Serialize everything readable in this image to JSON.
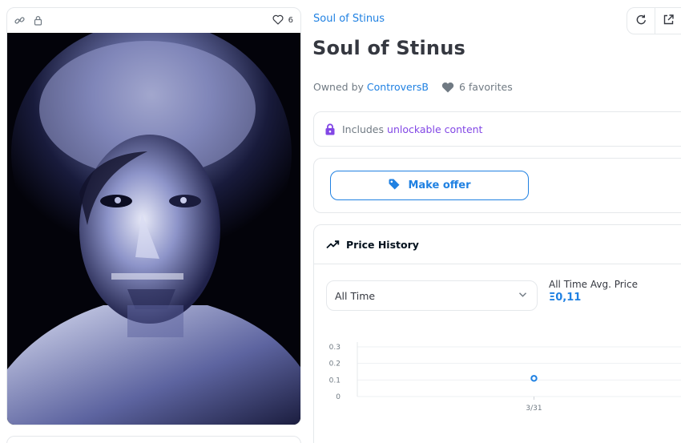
{
  "asset": {
    "favorite_count": "6",
    "collection_name": "Soul of Stinus",
    "title": "Soul of Stinus",
    "owned_by_label": "Owned by",
    "owner_name": "ControversB",
    "favorites_text": "6 favorites"
  },
  "unlockable": {
    "prefix": "Includes",
    "link": "unlockable content"
  },
  "offer": {
    "button_label": "Make offer"
  },
  "price_history": {
    "title": "Price History",
    "range_selected": "All Time",
    "avg_label": "All Time Avg. Price",
    "avg_value": "Ξ0,11"
  },
  "icons": {
    "toolbar": [
      "link-icon",
      "lock-icon",
      "heart-outline-icon"
    ],
    "actions": [
      "refresh-icon",
      "external-link-icon"
    ],
    "accent": "#2081e2",
    "unlock_accent": "#8247e5"
  },
  "chart_data": {
    "type": "scatter",
    "x_ticks": [
      "3/31"
    ],
    "y_ticks": [
      "0.3",
      "0.2",
      "0.1",
      "0"
    ],
    "ylim": [
      0,
      0.3
    ],
    "points": [
      {
        "x": "3/31",
        "y": 0.11
      }
    ]
  }
}
